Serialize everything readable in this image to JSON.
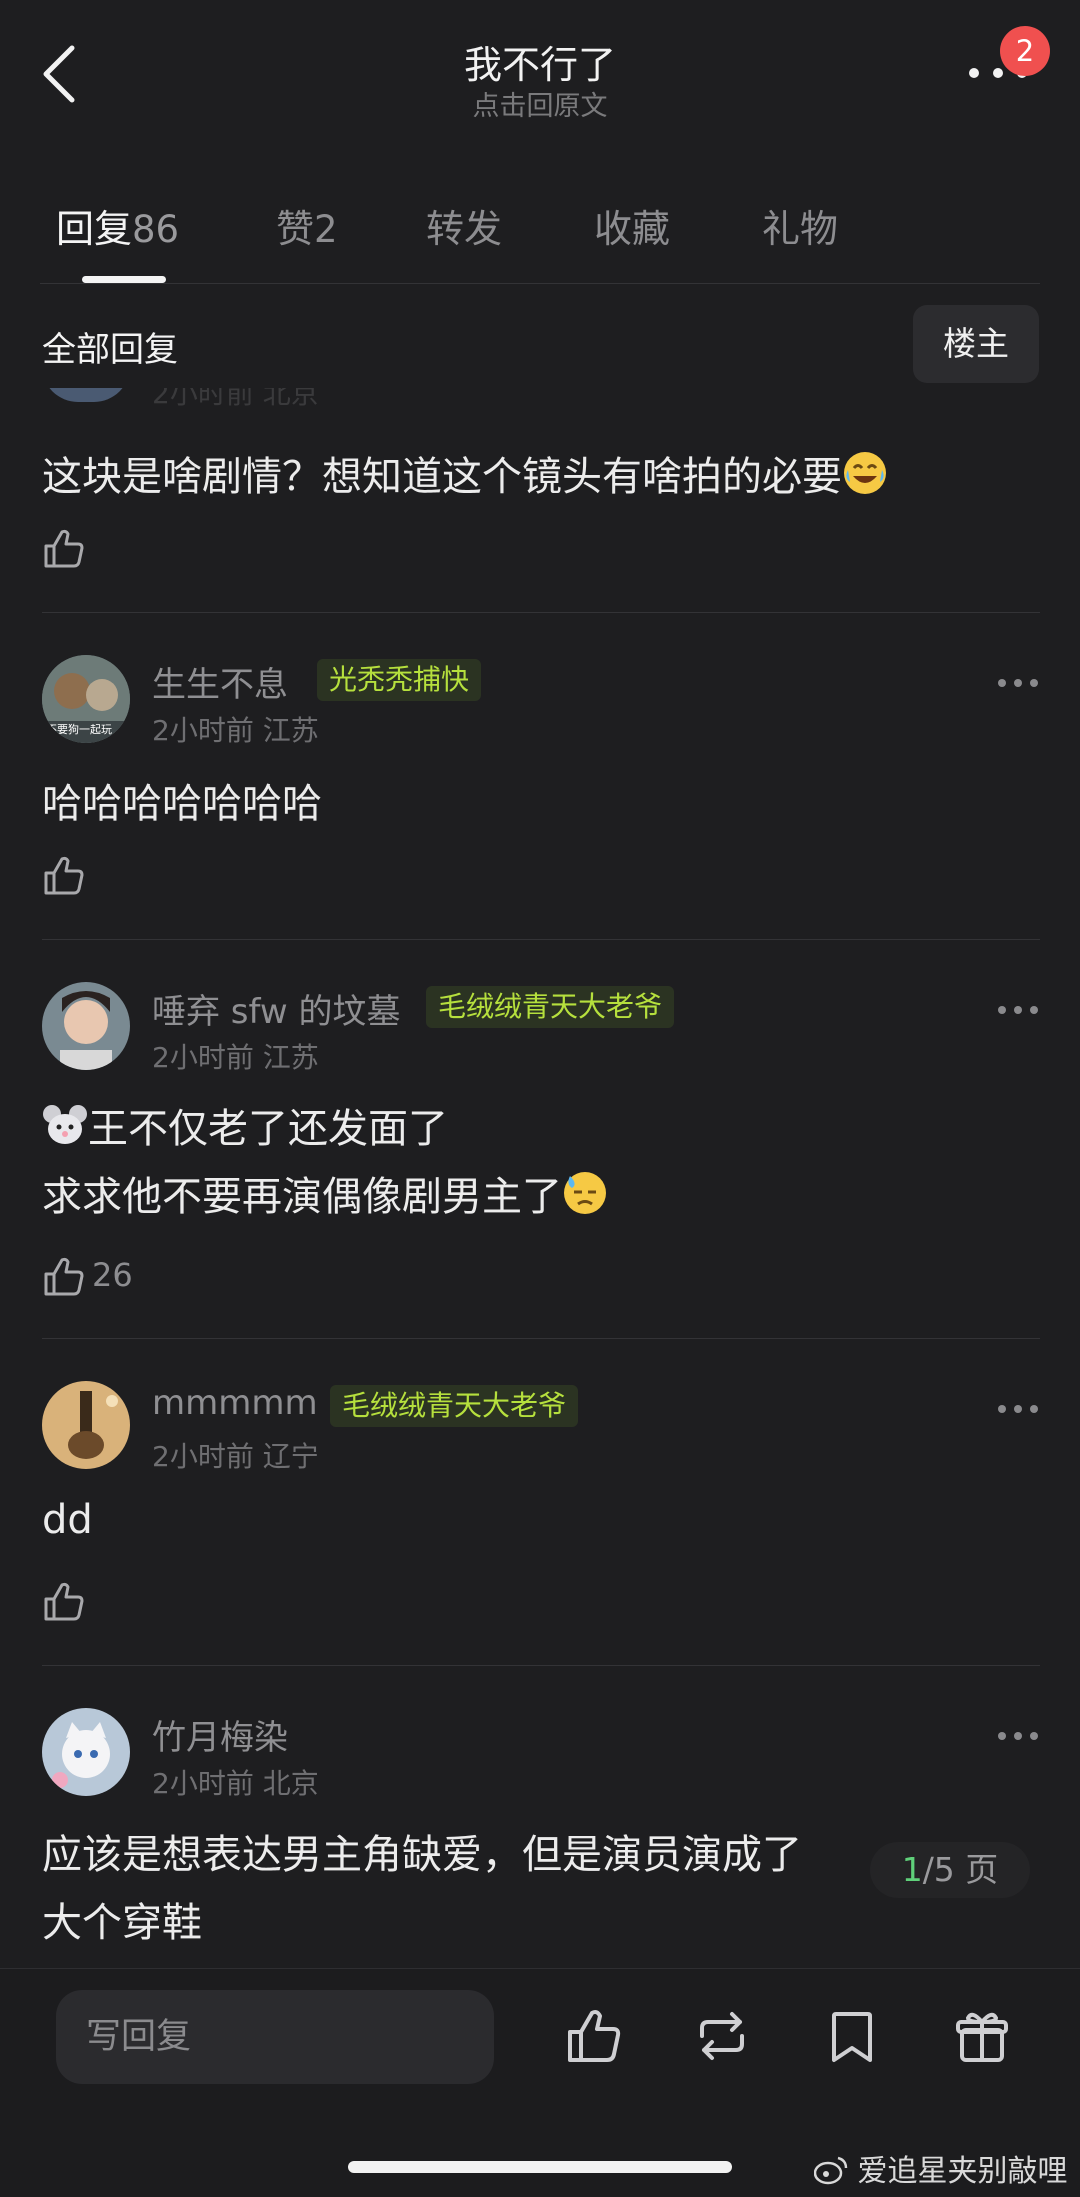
{
  "header": {
    "title": "我不行了",
    "subtitle": "点击回原文",
    "badge": "2"
  },
  "tabs": [
    {
      "label": "回复",
      "count": "86"
    },
    {
      "label": "赞",
      "count": "2"
    },
    {
      "label": "转发",
      "count": ""
    },
    {
      "label": "收藏",
      "count": ""
    },
    {
      "label": "礼物",
      "count": ""
    }
  ],
  "filter": {
    "label": "全部回复",
    "op_button": "楼主"
  },
  "comments": [
    {
      "meta": "2小时前 北京",
      "text": "这块是啥剧情？想知道这个镜头有啥拍的必要",
      "emoji": "face-with-tears-of-joy",
      "likes": ""
    },
    {
      "user": "生生不息",
      "tag": "光秃秃捕快",
      "meta": "2小时前 江苏",
      "text": "哈哈哈哈哈哈哈",
      "likes": "",
      "avatar_text": "不要狗一起玩"
    },
    {
      "user": "唾弃 sfw 的坟墓",
      "tag": "毛绒绒青天大老爷",
      "meta": "2小时前 江苏",
      "text_line1": "王不仅老了还发面了",
      "text_line2": "求求他不要再演偶像剧男主了",
      "emoji_prefix": "mouse-face",
      "emoji_suffix": "downcast-face-with-sweat",
      "likes": "26"
    },
    {
      "user": "mmmmm",
      "tag": "毛绒绒青天大老爷",
      "meta": "2小时前 辽宁",
      "text": "dd",
      "likes": ""
    },
    {
      "user": "竹月梅染",
      "tag": "",
      "meta": "2小时前 北京",
      "text_line1": "应该是想表达男主角缺爱，但是演员演成了",
      "text_line2": "大个穿鞋",
      "likes": ""
    }
  ],
  "pager": {
    "current": "1",
    "total": "/5 页"
  },
  "bottom": {
    "reply_placeholder": "写回复"
  },
  "watermark": "爱追星夹别敲哩",
  "colors": {
    "background": "#1e1e20",
    "tag_text": "#b6e03d",
    "badge": "#f0504f",
    "pager_current": "#5fd07a"
  }
}
